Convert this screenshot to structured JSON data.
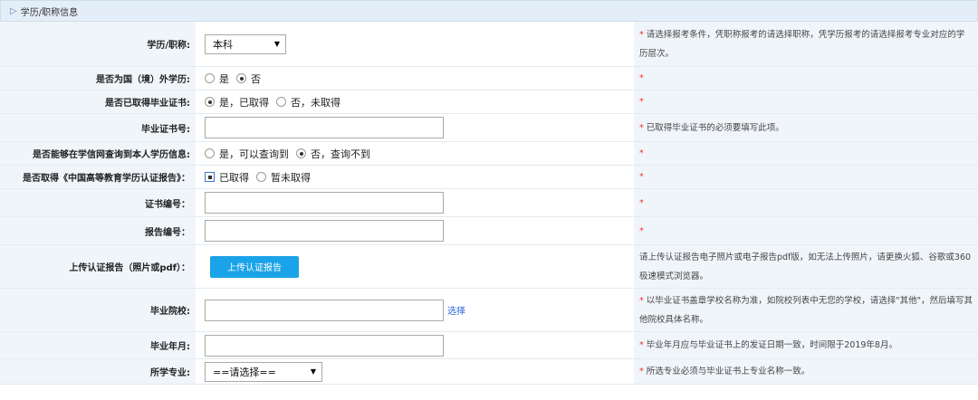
{
  "section": {
    "title": "学历/职称信息"
  },
  "fields": {
    "edu_level": {
      "label": "学历/职称:",
      "selected": "本科",
      "note": "请选择报考条件，凭职称报考的请选择职称，凭学历报考的请选择报考专业对应的学历层次。"
    },
    "foreign_degree": {
      "label": "是否为国（境）外学历:",
      "options": [
        "是",
        "否"
      ],
      "note": ""
    },
    "has_cert": {
      "label": "是否已取得毕业证书:",
      "options": [
        "是，已取得",
        "否，未取得"
      ],
      "note": ""
    },
    "cert_no": {
      "label": "毕业证书号:",
      "value": "",
      "note": "已取得毕业证书的必须要填写此项。"
    },
    "chsi_query": {
      "label": "是否能够在学信网查询到本人学历信息:",
      "options": [
        "是，可以查询到",
        "否，查询不到"
      ],
      "note": ""
    },
    "chsi_report": {
      "label": "是否取得《中国高等教育学历认证报告》：",
      "options": [
        "已取得",
        "暂未取得"
      ],
      "note": ""
    },
    "cert_code": {
      "label": "证书编号：",
      "value": "",
      "note": ""
    },
    "report_code": {
      "label": "报告编号：",
      "value": "",
      "note": ""
    },
    "upload_report": {
      "label": "上传认证报告（照片或pdf）：",
      "button": "上传认证报告",
      "note": "请上传认证报告电子照片或电子报告pdf版，如无法上传照片，请更换火狐、谷歌或360极速模式浏览器。"
    },
    "school": {
      "label": "毕业院校:",
      "value": "",
      "link": "选择",
      "note": "以毕业证书盖章学校名称为准，如院校列表中无您的学校，请选择\"其他\"，然后填写其他院校具体名称。"
    },
    "grad_date": {
      "label": "毕业年月:",
      "value": "",
      "note": "毕业年月应与毕业证书上的发证日期一致，时间限于2019年8月。"
    },
    "major": {
      "label": "所学专业:",
      "selected": "==请选择==",
      "note": "所选专业必须与毕业证书上专业名称一致。"
    }
  }
}
